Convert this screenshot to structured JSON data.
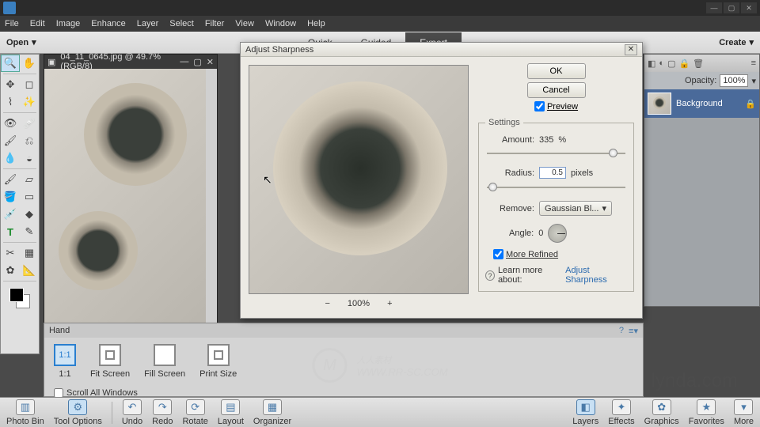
{
  "menubar": {
    "items": [
      "File",
      "Edit",
      "Image",
      "Enhance",
      "Layer",
      "Select",
      "Filter",
      "View",
      "Window",
      "Help"
    ]
  },
  "subbar": {
    "open": "Open",
    "modes": [
      "Quick",
      "Guided",
      "Expert"
    ],
    "active_mode": "Expert",
    "create": "Create"
  },
  "document": {
    "title": "04_11_0645.jpg @ 49.7% (RGB/8)",
    "zoom": "49.67%"
  },
  "dialog": {
    "title": "Adjust Sharpness",
    "ok": "OK",
    "cancel": "Cancel",
    "preview_label": "Preview",
    "preview_checked": true,
    "settings_legend": "Settings",
    "amount_label": "Amount:",
    "amount_value": "335",
    "amount_unit": "%",
    "radius_label": "Radius:",
    "radius_value": "0.5",
    "radius_unit": "pixels",
    "remove_label": "Remove:",
    "remove_value": "Gaussian Bl...",
    "angle_label": "Angle:",
    "angle_value": "0",
    "more_refined_label": "More Refined",
    "more_refined_checked": true,
    "learn_label": "Learn more about:",
    "learn_link": "Adjust Sharpness",
    "zoom_minus": "−",
    "zoom_pct": "100%",
    "zoom_plus": "+"
  },
  "layers": {
    "opacity_label": "Opacity:",
    "opacity_value": "100%",
    "items": [
      {
        "name": "Background",
        "locked": true
      }
    ]
  },
  "hand_panel": {
    "title": "Hand",
    "buttons": [
      {
        "label": "1:1",
        "text": "1:1"
      },
      {
        "label": "Fit Screen"
      },
      {
        "label": "Fill Screen"
      },
      {
        "label": "Print Size"
      }
    ],
    "scroll_all": "Scroll All Windows"
  },
  "bottombar": {
    "left": [
      {
        "label": "Photo Bin"
      },
      {
        "label": "Tool Options"
      }
    ],
    "mid": [
      {
        "label": "Undo"
      },
      {
        "label": "Redo"
      },
      {
        "label": "Rotate"
      },
      {
        "label": "Layout"
      },
      {
        "label": "Organizer"
      }
    ],
    "right": [
      {
        "label": "Layers"
      },
      {
        "label": "Effects"
      },
      {
        "label": "Graphics"
      },
      {
        "label": "Favorites"
      },
      {
        "label": "More"
      }
    ]
  },
  "watermarks": {
    "main": "人人素材",
    "sub": "WWW.RR-SC.COM",
    "right": "lynda.com"
  }
}
